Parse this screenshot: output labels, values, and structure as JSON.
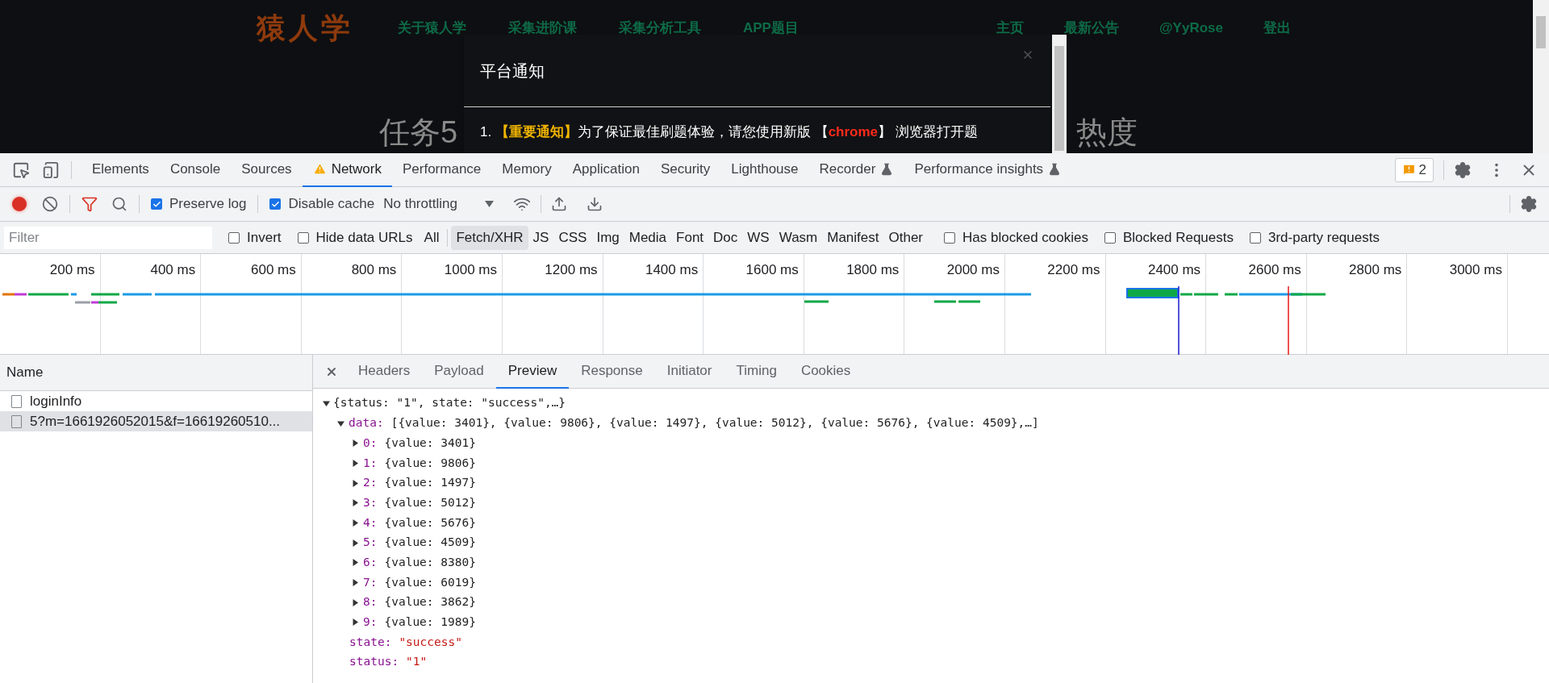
{
  "page": {
    "logo": "猿人学",
    "nav": [
      "关于猿人学",
      "采集进阶课",
      "采集分析工具",
      "APP题目"
    ],
    "nav_right": [
      "主页",
      "最新公告",
      "@YyRose",
      "登出"
    ],
    "heading_parts": [
      "任务5",
      "热度"
    ],
    "modal": {
      "title": "平台通知",
      "line": [
        {
          "kind": "plain",
          "text": "1. "
        },
        {
          "kind": "notice",
          "text": "【重要通知】"
        },
        {
          "kind": "plain",
          "text": "为了保证最佳刷题体验，请您使用新版 【"
        },
        {
          "kind": "alert",
          "text": "chrome"
        },
        {
          "kind": "plain",
          "text": "】 浏览器打开题"
        }
      ]
    }
  },
  "devtools": {
    "tabs": [
      {
        "label": "Elements",
        "selected": false,
        "warning": false,
        "experimental": false
      },
      {
        "label": "Console",
        "selected": false,
        "warning": false,
        "experimental": false
      },
      {
        "label": "Sources",
        "selected": false,
        "warning": false,
        "experimental": false
      },
      {
        "label": "Network",
        "selected": true,
        "warning": true,
        "experimental": false
      },
      {
        "label": "Performance",
        "selected": false,
        "warning": false,
        "experimental": false
      },
      {
        "label": "Memory",
        "selected": false,
        "warning": false,
        "experimental": false
      },
      {
        "label": "Application",
        "selected": false,
        "warning": false,
        "experimental": false
      },
      {
        "label": "Security",
        "selected": false,
        "warning": false,
        "experimental": false
      },
      {
        "label": "Lighthouse",
        "selected": false,
        "warning": false,
        "experimental": false
      },
      {
        "label": "Recorder",
        "selected": false,
        "warning": false,
        "experimental": true
      },
      {
        "label": "Performance insights",
        "selected": false,
        "warning": false,
        "experimental": true
      }
    ],
    "issues_count": "2",
    "toolbar": {
      "recording": true,
      "preserve_log": {
        "label": "Preserve log",
        "checked": true
      },
      "disable_cache": {
        "label": "Disable cache",
        "checked": true
      },
      "throttling": "No throttling"
    },
    "filter": {
      "placeholder": "Filter",
      "options_left": [
        {
          "label": "Invert",
          "checked": false
        },
        {
          "label": "Hide data URLs",
          "checked": false
        }
      ],
      "types": [
        {
          "label": "All",
          "selected": false
        },
        {
          "label": "Fetch/XHR",
          "selected": true
        },
        {
          "label": "JS",
          "selected": false
        },
        {
          "label": "CSS",
          "selected": false
        },
        {
          "label": "Img",
          "selected": false
        },
        {
          "label": "Media",
          "selected": false
        },
        {
          "label": "Font",
          "selected": false
        },
        {
          "label": "Doc",
          "selected": false
        },
        {
          "label": "WS",
          "selected": false
        },
        {
          "label": "Wasm",
          "selected": false
        },
        {
          "label": "Manifest",
          "selected": false
        },
        {
          "label": "Other",
          "selected": false
        }
      ],
      "options_right": [
        {
          "label": "Has blocked cookies",
          "checked": false
        },
        {
          "label": "Blocked Requests",
          "checked": false
        },
        {
          "label": "3rd-party requests",
          "checked": false
        }
      ]
    },
    "timeline_ticks": [
      "200 ms",
      "400 ms",
      "600 ms",
      "800 ms",
      "1000 ms",
      "1200 ms",
      "1400 ms",
      "1600 ms",
      "1800 ms",
      "2000 ms",
      "2200 ms",
      "2400 ms",
      "2600 ms",
      "2800 ms",
      "3000 ms"
    ],
    "name_header": "Name",
    "requests": [
      {
        "name": "loginInfo",
        "selected": false
      },
      {
        "name": "5?m=1661926052015&f=16619260510...",
        "selected": true
      }
    ],
    "detail_tabs": [
      {
        "label": "Headers",
        "selected": false
      },
      {
        "label": "Payload",
        "selected": false
      },
      {
        "label": "Preview",
        "selected": true
      },
      {
        "label": "Response",
        "selected": false
      },
      {
        "label": "Initiator",
        "selected": false
      },
      {
        "label": "Timing",
        "selected": false
      },
      {
        "label": "Cookies",
        "selected": false
      }
    ],
    "preview": {
      "summary": "{status: \"1\", state: \"success\",…}",
      "expanded": true,
      "children": [
        {
          "kind": "object",
          "key": "data:",
          "summary": "[{value: 3401}, {value: 9806}, {value: 1497}, {value: 5012}, {value: 5676}, {value: 4509},…]",
          "expanded": true,
          "children": [
            {
              "kind": "object",
              "key": "0:",
              "summary": "{value: 3401}",
              "expanded": false
            },
            {
              "kind": "object",
              "key": "1:",
              "summary": "{value: 9806}",
              "expanded": false
            },
            {
              "kind": "object",
              "key": "2:",
              "summary": "{value: 1497}",
              "expanded": false
            },
            {
              "kind": "object",
              "key": "3:",
              "summary": "{value: 5012}",
              "expanded": false
            },
            {
              "kind": "object",
              "key": "4:",
              "summary": "{value: 5676}",
              "expanded": false
            },
            {
              "kind": "object",
              "key": "5:",
              "summary": "{value: 4509}",
              "expanded": false
            },
            {
              "kind": "object",
              "key": "6:",
              "summary": "{value: 8380}",
              "expanded": false
            },
            {
              "kind": "object",
              "key": "7:",
              "summary": "{value: 6019}",
              "expanded": false
            },
            {
              "kind": "object",
              "key": "8:",
              "summary": "{value: 3862}",
              "expanded": false
            },
            {
              "kind": "object",
              "key": "9:",
              "summary": "{value: 1989}",
              "expanded": false
            }
          ]
        },
        {
          "kind": "string",
          "key": "state:",
          "value": "\"success\""
        },
        {
          "kind": "string",
          "key": "status:",
          "value": "\"1\""
        }
      ]
    }
  }
}
